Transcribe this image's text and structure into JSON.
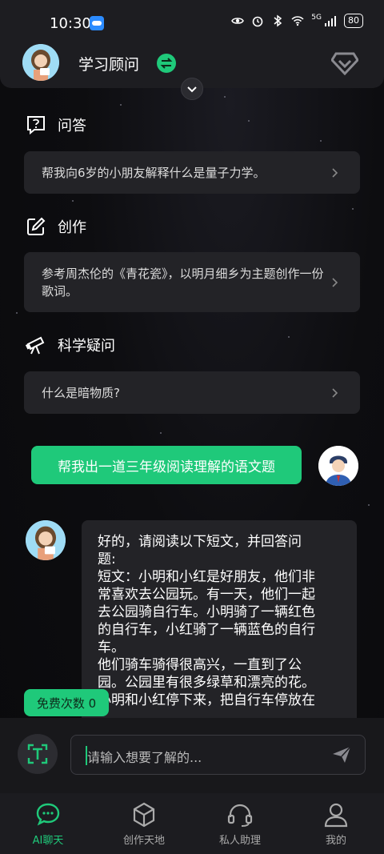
{
  "status_bar": {
    "time": "10:30",
    "battery": "80",
    "signal_label": "5G"
  },
  "header": {
    "title": "学习顾问"
  },
  "sections": [
    {
      "title": "问答",
      "icon": "question-icon",
      "prompt": "帮我向6岁的小朋友解释什么是量子力学。"
    },
    {
      "title": "创作",
      "icon": "edit-icon",
      "prompt": "参考周杰伦的《青花瓷》，以明月细乡为主题创作一份歌词。"
    },
    {
      "title": "科学疑问",
      "icon": "telescope-icon",
      "prompt": "什么是暗物质?"
    }
  ],
  "chat": {
    "user_message": "帮我出一道三年级阅读理解的语文题",
    "ai_lines": [
      "好的，请阅读以下短文，并回答问",
      "题:",
      "短文：小明和小红是好朋友，他们非",
      "常喜欢去公园玩。有一天，他们一起",
      "去公园骑自行车。小明骑了一辆红色",
      "的自行车，小红骑了一辆蓝色的自行",
      "车。",
      "他们骑车骑得很高兴，一直到了公",
      "园。公园里有很多绿草和漂亮的花。",
      "小明和小红停下来，把自行车停放在"
    ]
  },
  "free_badge": "免费次数 0",
  "input": {
    "placeholder": "请输入想要了解的..."
  },
  "tabs": [
    {
      "label": "AI聊天",
      "icon": "chat-icon",
      "active": true
    },
    {
      "label": "创作天地",
      "icon": "cube-icon",
      "active": false
    },
    {
      "label": "私人助理",
      "icon": "headset-icon",
      "active": false
    },
    {
      "label": "我的",
      "icon": "person-icon",
      "active": false
    }
  ],
  "colors": {
    "accent": "#1fc97a",
    "card": "#232327",
    "background": "#0d0d10"
  }
}
